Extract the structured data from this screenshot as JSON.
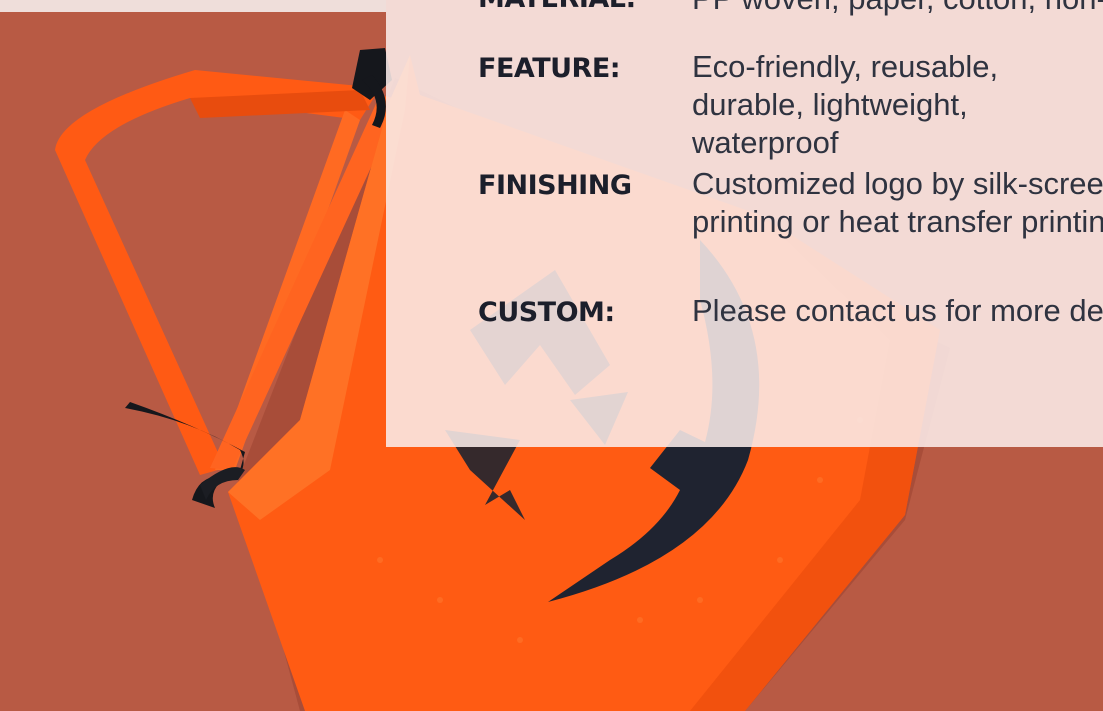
{
  "specs": {
    "material": {
      "label": "MATERIAL:",
      "value": "PP woven, paper, cotton, non-woven"
    },
    "feature": {
      "label": "FEATURE:",
      "value": "Eco-friendly, reusable, durable, lightweight, waterproof"
    },
    "finishing": {
      "label": "FINISHING",
      "value": "Customized logo by silk-screen printing or heat transfer printing"
    },
    "custom": {
      "label": "CUSTOM:",
      "value": "Please contact us for more details"
    }
  },
  "colors": {
    "background": "#b85a44",
    "bag_orange": "#ff5a12",
    "face_print": "#1f2330",
    "panel": "#faece9"
  },
  "icons": [
    "pumpkin-bag-image"
  ]
}
